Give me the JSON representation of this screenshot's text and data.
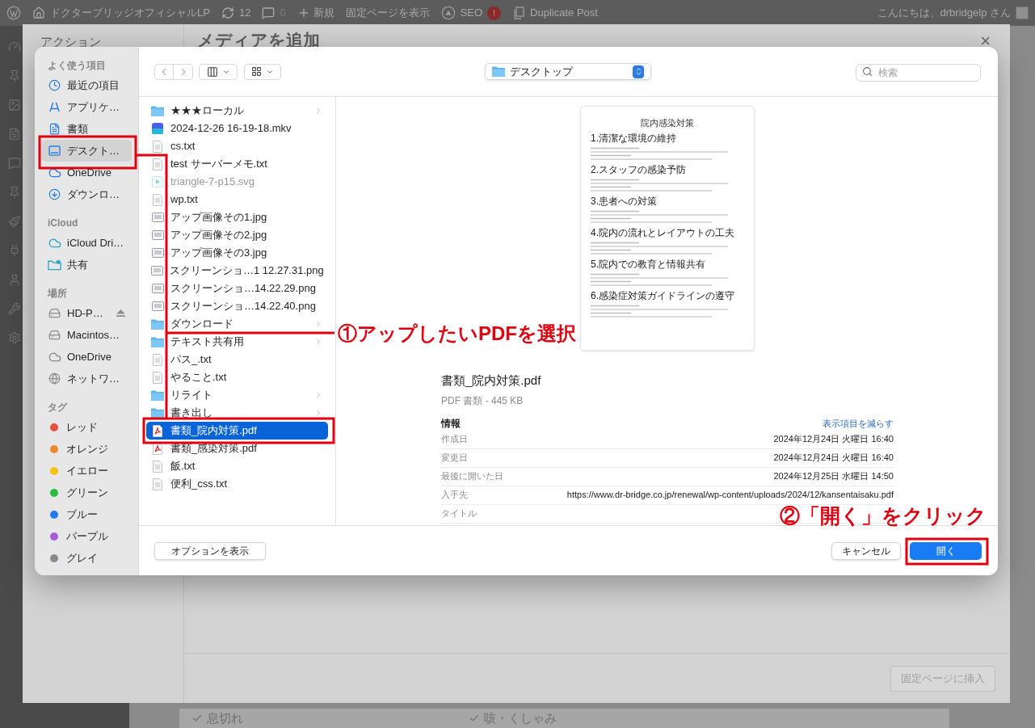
{
  "admin_bar": {
    "site": "ドクターブリッジオフィシャルLP",
    "updates": "12",
    "comments": "0",
    "new": "新規",
    "view_page": "固定ページを表示",
    "seo": "SEO",
    "seo_badge": "!",
    "duplicate": "Duplicate Post",
    "greeting": "こんにちは、drbridgelp さん"
  },
  "media_modal": {
    "sidebar_title": "アクション",
    "title": "メディアを追加",
    "close": "×",
    "insert_button": "固定ページに挿入"
  },
  "background_checks": [
    {
      "label": "息切れ",
      "checked": true
    },
    {
      "label": "咳・くしゃみ",
      "checked": true
    }
  ],
  "dialog": {
    "toolbar": {
      "location": "デスクトップ",
      "search_placeholder": "検索"
    },
    "sidebar": [
      {
        "title": "よく使う項目",
        "items": [
          {
            "label": "最近の項目",
            "selected": false
          },
          {
            "label": "アプリケ…",
            "selected": false
          },
          {
            "label": "書類",
            "selected": false
          },
          {
            "label": "デスクト…",
            "selected": true
          },
          {
            "label": "OneDrive",
            "selected": false
          },
          {
            "label": "ダウンロ…",
            "selected": false
          }
        ]
      },
      {
        "title": "iCloud",
        "items": [
          {
            "label": "iCloud Dri…",
            "selected": false
          },
          {
            "label": "共有",
            "selected": false
          }
        ]
      },
      {
        "title": "場所",
        "items": [
          {
            "label": "HD-P…",
            "selected": false
          },
          {
            "label": "Macintos…",
            "selected": false
          },
          {
            "label": "OneDrive",
            "selected": false
          },
          {
            "label": "ネットワ…",
            "selected": false
          }
        ]
      },
      {
        "title": "タグ",
        "items": [
          {
            "label": "レッド",
            "color": "#eb4e3d"
          },
          {
            "label": "オレンジ",
            "color": "#f0892b"
          },
          {
            "label": "イエロー",
            "color": "#f5c315"
          },
          {
            "label": "グリーン",
            "color": "#29be3c"
          },
          {
            "label": "ブルー",
            "color": "#1d7cf2"
          },
          {
            "label": "パープル",
            "color": "#a85ad6"
          },
          {
            "label": "グレイ",
            "color": "#8a8a8e"
          }
        ]
      }
    ],
    "files": [
      {
        "name": "★★★ローカル",
        "kind": "folder",
        "disabled": false,
        "selected": false
      },
      {
        "name": "2024-12-26 16-19-18.mkv",
        "kind": "video",
        "disabled": false,
        "selected": false
      },
      {
        "name": "cs.txt",
        "kind": "text",
        "disabled": false,
        "selected": false
      },
      {
        "name": "test サーバーメモ.txt",
        "kind": "text",
        "disabled": false,
        "selected": false
      },
      {
        "name": "triangle-7-p15.svg",
        "kind": "svg",
        "disabled": true,
        "selected": false
      },
      {
        "name": "wp.txt",
        "kind": "text",
        "disabled": false,
        "selected": false
      },
      {
        "name": "アップ画像その1.jpg",
        "kind": "image",
        "disabled": false,
        "selected": false
      },
      {
        "name": "アップ画像その2.jpg",
        "kind": "image",
        "disabled": false,
        "selected": false
      },
      {
        "name": "アップ画像その3.jpg",
        "kind": "image",
        "disabled": false,
        "selected": false
      },
      {
        "name": "スクリーンショ…1 12.27.31.png",
        "kind": "image",
        "disabled": false,
        "selected": false
      },
      {
        "name": "スクリーンショ…14.22.29.png",
        "kind": "image",
        "disabled": false,
        "selected": false
      },
      {
        "name": "スクリーンショ…14.22.40.png",
        "kind": "image",
        "disabled": false,
        "selected": false
      },
      {
        "name": "ダウンロード",
        "kind": "folder",
        "disabled": false,
        "selected": false
      },
      {
        "name": "テキスト共有用",
        "kind": "folder",
        "disabled": false,
        "selected": false
      },
      {
        "name": "パス_.txt",
        "kind": "text",
        "disabled": false,
        "selected": false
      },
      {
        "name": "やること.txt",
        "kind": "text",
        "disabled": false,
        "selected": false
      },
      {
        "name": "リライト",
        "kind": "folder",
        "disabled": false,
        "selected": false
      },
      {
        "name": "書き出し",
        "kind": "folder",
        "disabled": false,
        "selected": false
      },
      {
        "name": "書類_院内対策.pdf",
        "kind": "pdf",
        "disabled": false,
        "selected": true
      },
      {
        "name": "書類_感染対策.pdf",
        "kind": "pdf",
        "disabled": false,
        "selected": false
      },
      {
        "name": "飯.txt",
        "kind": "text",
        "disabled": false,
        "selected": false
      },
      {
        "name": "便利_css.txt",
        "kind": "text",
        "disabled": false,
        "selected": false
      }
    ],
    "preview": {
      "document": {
        "title": "院内感染対策",
        "headings": [
          "1.清潔な環境の維持",
          "2.スタッフの感染予防",
          "3.患者への対策",
          "4.院内の流れとレイアウトの工夫",
          "5.院内での教育と情報共有",
          "6.感染症対策ガイドラインの遵守"
        ]
      },
      "file_name": "書類_院内対策.pdf",
      "file_type": "PDF 書類 - 445 KB",
      "info_title": "情報",
      "less_link": "表示項目を減らす",
      "info_rows": [
        {
          "label": "作成日",
          "value": "2024年12月24日 火曜日 16:40"
        },
        {
          "label": "変更日",
          "value": "2024年12月24日 火曜日 16:40"
        },
        {
          "label": "最後に開いた日",
          "value": "2024年12月25日 水曜日 14:50"
        },
        {
          "label": "入手先",
          "value": "https://www.dr-bridge.co.jp/renewal/wp-content/uploads/2024/12/kansentaisaku.pdf"
        },
        {
          "label": "タイトル"
        }
      ]
    },
    "buttons": {
      "options": "オプションを表示",
      "cancel": "キャンセル",
      "open": "開く"
    }
  },
  "annotations": [
    {
      "text": "①アップしたいPDFを選択"
    },
    {
      "text": "②「開く」をクリック"
    }
  ]
}
